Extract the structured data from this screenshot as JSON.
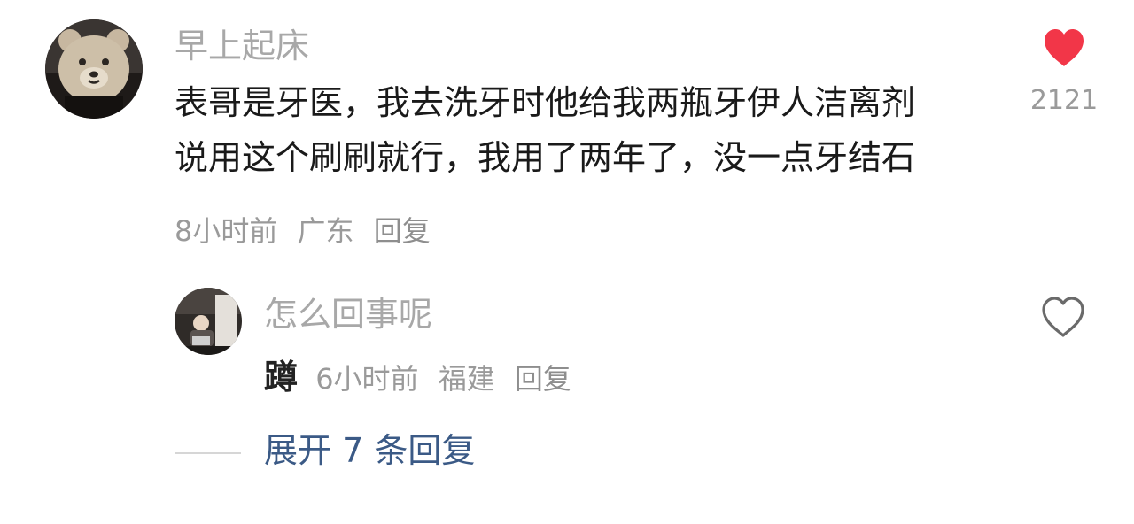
{
  "comment": {
    "username": "早上起床",
    "text_line1": "表哥是牙医，我去洗牙时他给我两瓶牙伊人洁离剂",
    "text_line2": "说用这个刷刷就行，我用了两年了，没一点牙结石",
    "time": "8小时前",
    "location": "广东",
    "reply_label": "回复",
    "like_count": "2121",
    "liked": true,
    "like_color": "#f23648"
  },
  "reply": {
    "username": "怎么回事呢",
    "sticker_text": "蹲",
    "time": "6小时前",
    "location": "福建",
    "reply_label": "回复",
    "liked": false
  },
  "expand": {
    "label": "展开 7 条回复"
  }
}
